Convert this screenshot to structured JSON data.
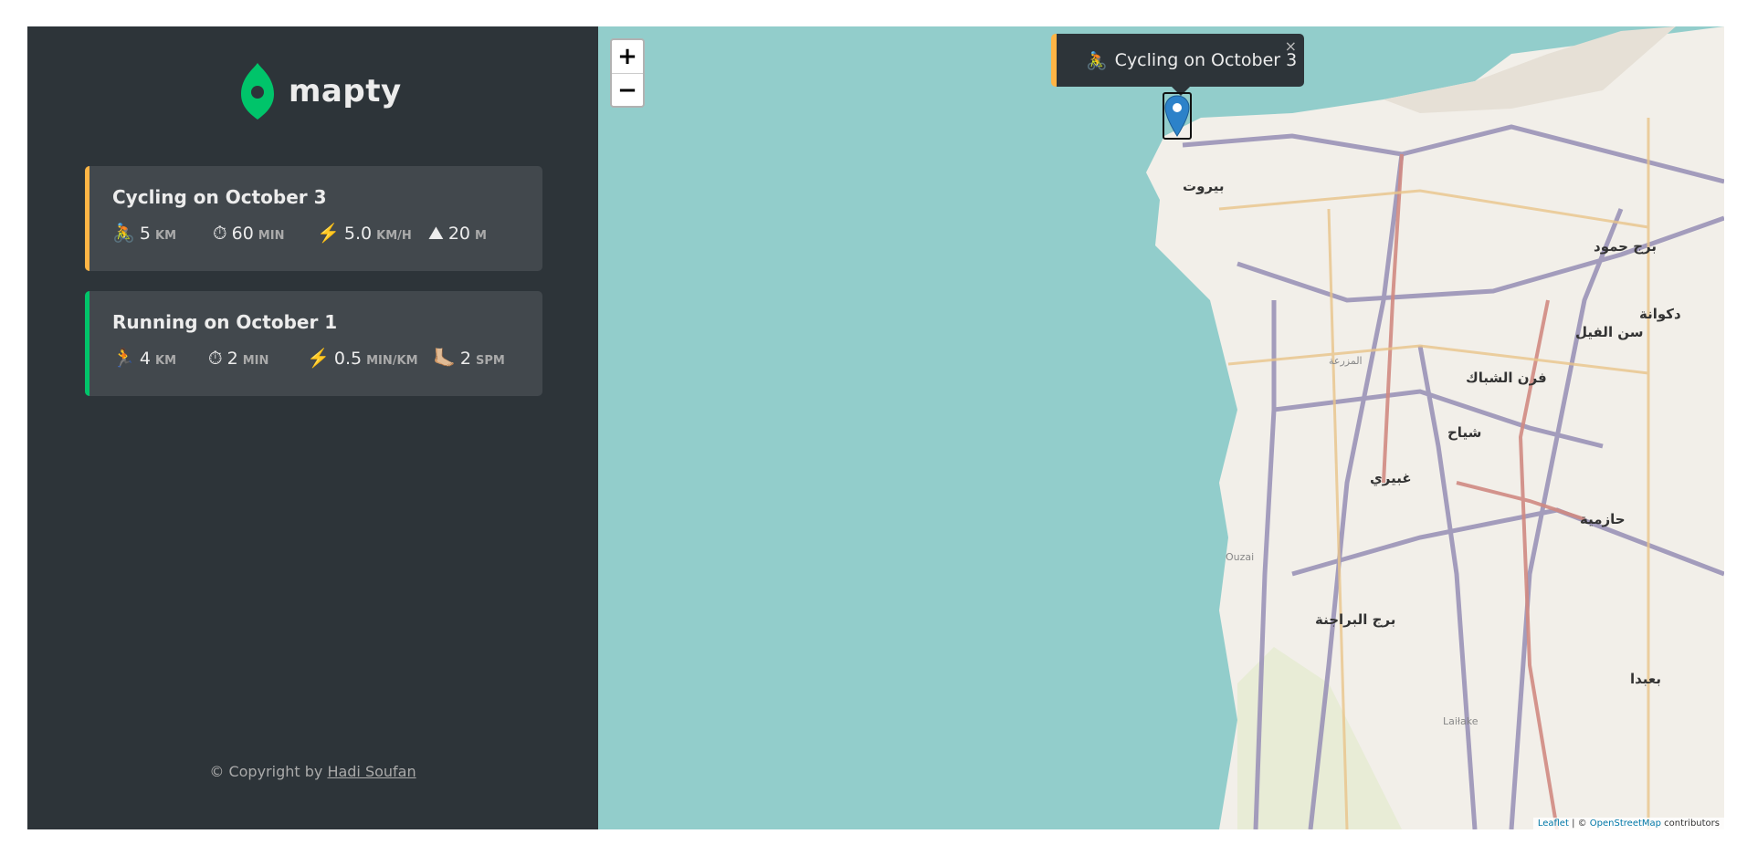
{
  "logo": {
    "text": "mapty"
  },
  "workouts": [
    {
      "type": "cycling",
      "title": "Cycling on October 3",
      "color": "#ffb545",
      "details": [
        {
          "icon": "🚴",
          "value": "5",
          "unit": "km"
        },
        {
          "icon": "⏱",
          "value": "60",
          "unit": "min"
        },
        {
          "icon": "⚡️",
          "value": "5.0",
          "unit": "km/h"
        },
        {
          "icon": "⛰",
          "value": "20",
          "unit": "m"
        }
      ]
    },
    {
      "type": "running",
      "title": "Running on October 1",
      "color": "#00c46a",
      "details": [
        {
          "icon": "🏃",
          "value": "4",
          "unit": "km"
        },
        {
          "icon": "⏱",
          "value": "2",
          "unit": "min"
        },
        {
          "icon": "⚡️",
          "value": "0.5",
          "unit": "min/km"
        },
        {
          "icon": "🦶🏼",
          "value": "2",
          "unit": "spm"
        }
      ]
    }
  ],
  "copyright": {
    "prefix": "© Copyright by ",
    "author": "Hadi Soufan"
  },
  "map": {
    "zoom_in": "+",
    "zoom_out": "−",
    "popup": {
      "icon": "🚴",
      "text": "Cycling on October 3",
      "close": "×"
    },
    "attribution": {
      "leaflet": "Leaflet",
      "sep": " | © ",
      "osm": "OpenStreetMap",
      "suffix": " contributors"
    },
    "labels": [
      "بيروت",
      "برج حمود",
      "دكوانة",
      "سن الفيل",
      "فرن الشباك",
      "شياح",
      "غبيري",
      "حازمية",
      "برج البراجنة",
      "بعبدا",
      "المزرعة",
      "Ouzai",
      "Laiłake"
    ]
  },
  "colors": {
    "sidebar": "#2d3439",
    "card": "#42484d",
    "sea": "#92cdcb",
    "land": "#f2efe9"
  }
}
